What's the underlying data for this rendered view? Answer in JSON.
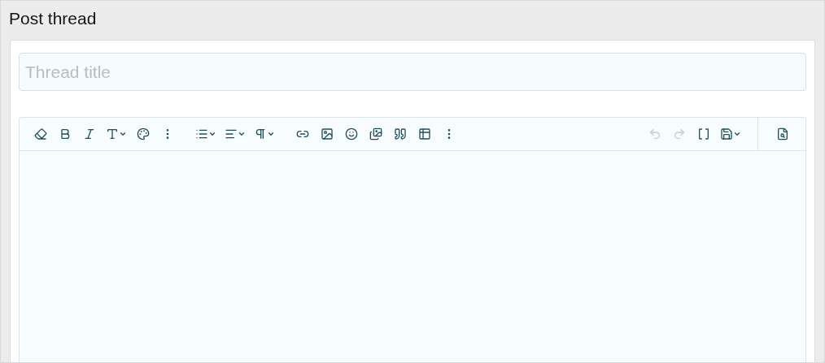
{
  "page": {
    "title": "Post thread"
  },
  "title_field": {
    "placeholder": "Thread title"
  },
  "toolbar": {
    "groups": [
      {
        "items": [
          {
            "dropdown": false,
            "disabled": false
          },
          {
            "dropdown": false,
            "disabled": false
          },
          {
            "dropdown": false,
            "disabled": false
          },
          {
            "dropdown": true,
            "disabled": false
          },
          {
            "dropdown": false,
            "disabled": false
          },
          {
            "dropdown": false,
            "disabled": false
          }
        ]
      },
      {
        "items": [
          {
            "dropdown": true,
            "disabled": false
          },
          {
            "dropdown": true,
            "disabled": false
          },
          {
            "dropdown": true,
            "disabled": false
          }
        ]
      },
      {
        "items": [
          {
            "dropdown": false,
            "disabled": false
          },
          {
            "dropdown": false,
            "disabled": false
          },
          {
            "dropdown": false,
            "disabled": false
          },
          {
            "dropdown": false,
            "disabled": false
          },
          {
            "dropdown": false,
            "disabled": false
          },
          {
            "dropdown": false,
            "disabled": false
          },
          {
            "dropdown": false,
            "disabled": false
          }
        ]
      },
      {
        "items": [
          {
            "dropdown": false,
            "disabled": true
          },
          {
            "dropdown": false,
            "disabled": true
          },
          {
            "dropdown": false,
            "disabled": false
          },
          {
            "dropdown": true,
            "disabled": false
          }
        ]
      },
      {
        "items": [
          {
            "dropdown": false,
            "disabled": false
          }
        ]
      }
    ]
  }
}
